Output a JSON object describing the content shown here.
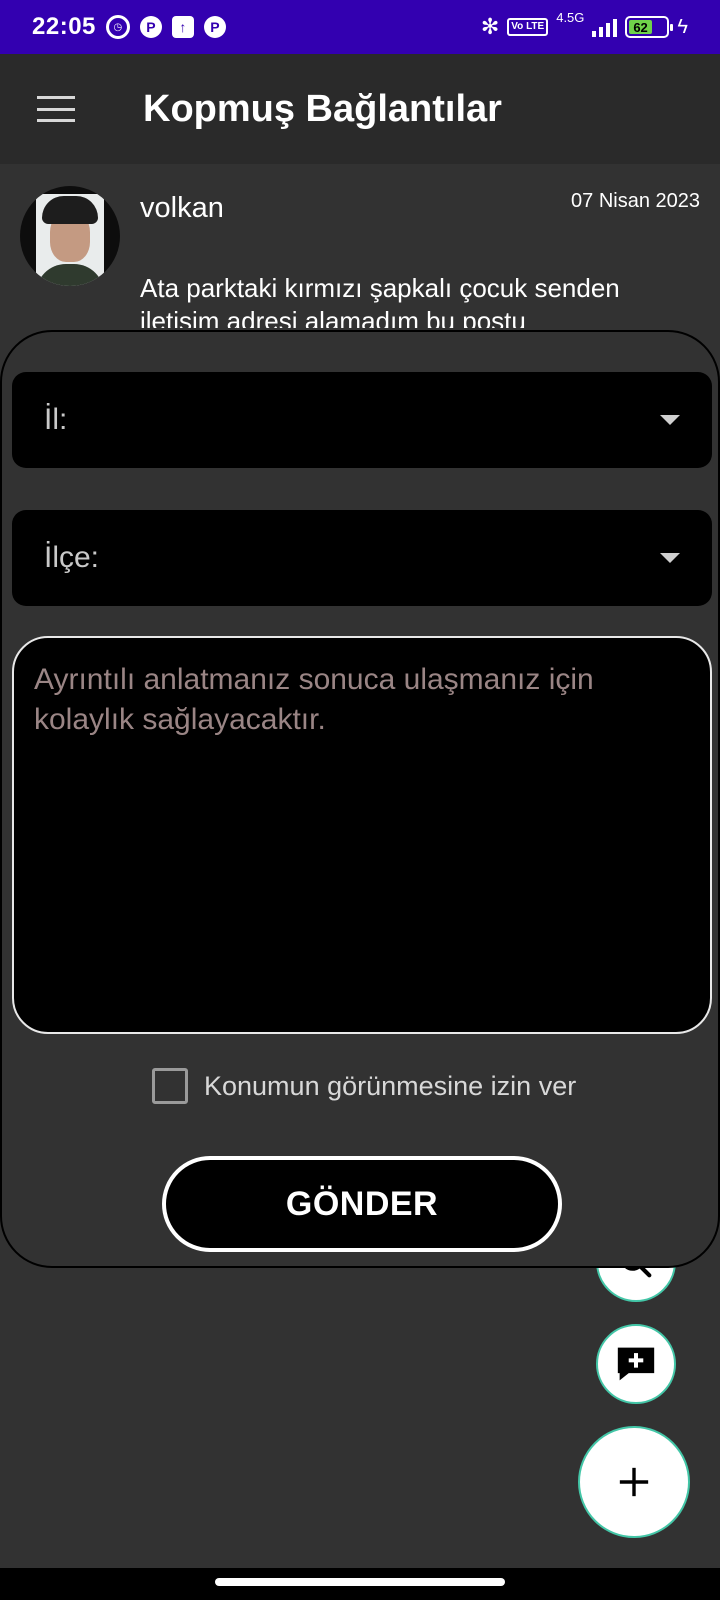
{
  "status_bar": {
    "time": "22:05",
    "network": "4.5G",
    "volte": "Vo LTE",
    "battery": "62"
  },
  "app_bar": {
    "title": "Kopmuş Bağlantılar"
  },
  "post": {
    "username": "volkan",
    "date": "07 Nisan 2023",
    "text": "Ata parktaki kırmızı şapkalı çocuk senden iletişim adresi alamadım bu postu"
  },
  "form": {
    "province_label": "İl:",
    "district_label": "İlçe:",
    "details_placeholder": "Ayrıntılı anlatmanız sonuca ulaşmanız için kolaylık sağlayacaktır.",
    "location_checkbox_label": "Konumun görünmesine izin ver",
    "location_checked": false,
    "send_label": "GÖNDER"
  },
  "fabs": {
    "search_icon": "search-icon",
    "comment_icon": "add-comment-icon",
    "add_icon": "plus-icon"
  },
  "colors": {
    "status_bar": "#3300b0",
    "app_bar": "#2a2a2a",
    "background": "#323232",
    "fab_border": "#43c6a7",
    "placeholder": "#9a8585"
  }
}
